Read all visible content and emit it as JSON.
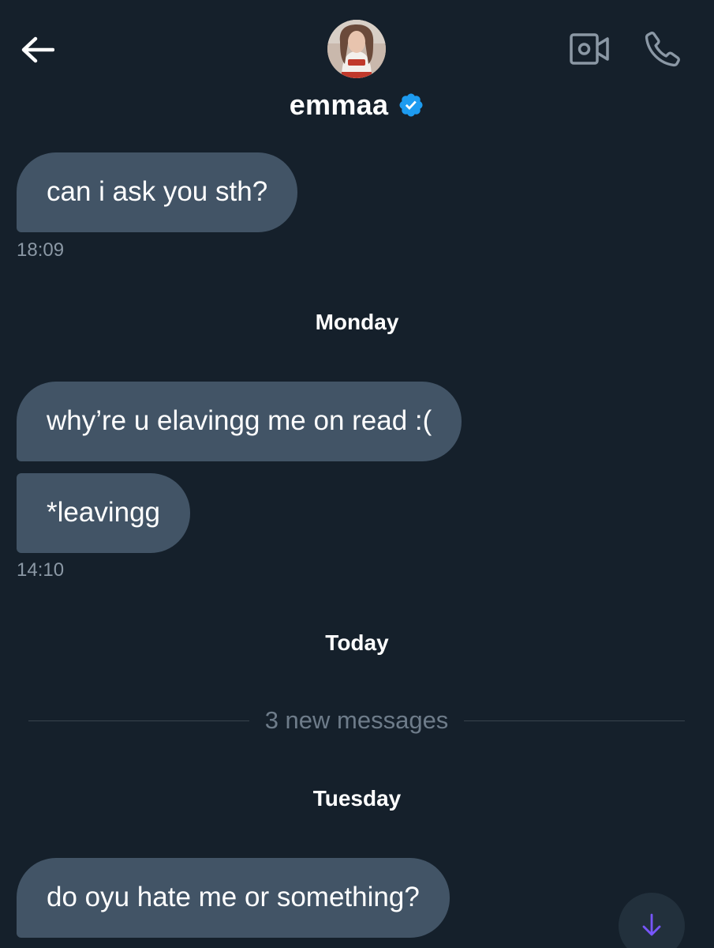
{
  "header": {
    "contact_name": "emmaa",
    "back_icon": "arrow-left-icon",
    "video_icon": "video-camera-icon",
    "call_icon": "phone-icon",
    "verified_icon": "verified-badge-icon",
    "verified_color": "#1d9bf0"
  },
  "messages": [
    {
      "text": "can i ask you sth?"
    },
    {
      "timestamp": "18:09"
    },
    {
      "day": "Monday"
    },
    {
      "text": "why’re u elavingg me on read :("
    },
    {
      "text": "*leavingg"
    },
    {
      "timestamp": "14:10"
    },
    {
      "day": "Today"
    },
    {
      "divider": "3 new messages"
    },
    {
      "day": "Tuesday"
    },
    {
      "text": "do oyu hate me or something?"
    }
  ],
  "scroll_button": {
    "icon": "arrow-down-icon",
    "color": "#7856ff"
  },
  "colors": {
    "background": "#15202b",
    "bubble": "#425466",
    "muted_text": "#8b98a5"
  }
}
